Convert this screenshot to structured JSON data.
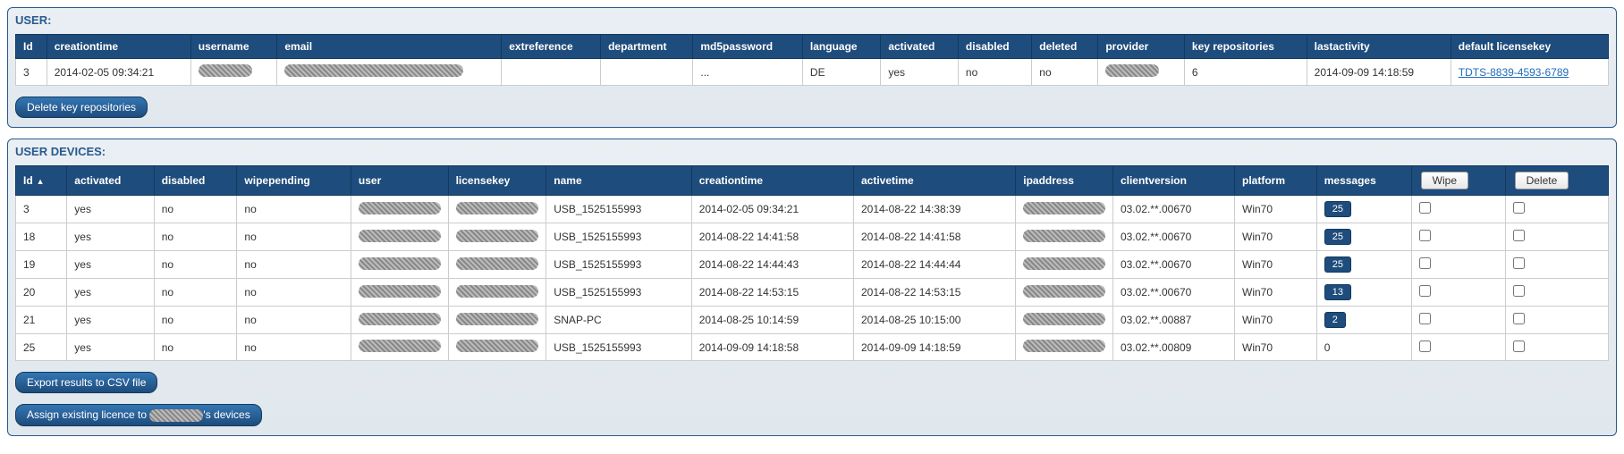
{
  "user_panel": {
    "title": "USER:",
    "headers": {
      "id": "Id",
      "creationtime": "creationtime",
      "username": "username",
      "email": "email",
      "extreference": "extreference",
      "department": "department",
      "md5password": "md5password",
      "language": "language",
      "activated": "activated",
      "disabled": "disabled",
      "deleted": "deleted",
      "provider": "provider",
      "keyrepos": "key repositories",
      "lastactivity": "lastactivity",
      "licensekey": "default licensekey"
    },
    "row": {
      "id": "3",
      "creationtime": "2014-02-05 09:34:21",
      "md5password": "...",
      "language": "DE",
      "activated": "yes",
      "disabled": "no",
      "deleted": "no",
      "keyrepos": "6",
      "lastactivity": "2014-09-09 14:18:59",
      "licensekey": "TDTS-8839-4593-6789"
    },
    "delete_button": "Delete key repositories"
  },
  "devices_panel": {
    "title": "USER DEVICES:",
    "headers": {
      "id": "Id",
      "activated": "activated",
      "disabled": "disabled",
      "wipepending": "wipepending",
      "user": "user",
      "licensekey": "licensekey",
      "name": "name",
      "creationtime": "creationtime",
      "activetime": "activetime",
      "ipaddress": "ipaddress",
      "clientversion": "clientversion",
      "platform": "platform",
      "messages": "messages",
      "wipe": "Wipe",
      "delete": "Delete"
    },
    "rows": [
      {
        "id": "3",
        "activated": "yes",
        "disabled": "no",
        "wipepending": "no",
        "name": "USB_1525155993",
        "creationtime": "2014-02-05 09:34:21",
        "activetime": "2014-08-22 14:38:39",
        "clientversion": "03.02.**.00670",
        "platform": "Win70",
        "messages": "25",
        "badge": true
      },
      {
        "id": "18",
        "activated": "yes",
        "disabled": "no",
        "wipepending": "no",
        "name": "USB_1525155993",
        "creationtime": "2014-08-22 14:41:58",
        "activetime": "2014-08-22 14:41:58",
        "clientversion": "03.02.**.00670",
        "platform": "Win70",
        "messages": "25",
        "badge": true
      },
      {
        "id": "19",
        "activated": "yes",
        "disabled": "no",
        "wipepending": "no",
        "name": "USB_1525155993",
        "creationtime": "2014-08-22 14:44:43",
        "activetime": "2014-08-22 14:44:44",
        "clientversion": "03.02.**.00670",
        "platform": "Win70",
        "messages": "25",
        "badge": true
      },
      {
        "id": "20",
        "activated": "yes",
        "disabled": "no",
        "wipepending": "no",
        "name": "USB_1525155993",
        "creationtime": "2014-08-22 14:53:15",
        "activetime": "2014-08-22 14:53:15",
        "clientversion": "03.02.**.00670",
        "platform": "Win70",
        "messages": "13",
        "badge": true
      },
      {
        "id": "21",
        "activated": "yes",
        "disabled": "no",
        "wipepending": "no",
        "name": "SNAP-PC",
        "creationtime": "2014-08-25 10:14:59",
        "activetime": "2014-08-25 10:15:00",
        "clientversion": "03.02.**.00887",
        "platform": "Win70",
        "messages": "2",
        "badge": true
      },
      {
        "id": "25",
        "activated": "yes",
        "disabled": "no",
        "wipepending": "no",
        "name": "USB_1525155993",
        "creationtime": "2014-09-09 14:18:58",
        "activetime": "2014-09-09 14:18:59",
        "clientversion": "03.02.**.00809",
        "platform": "Win70",
        "messages": "0",
        "badge": false
      }
    ],
    "export_button": "Export results to CSV file",
    "assign_button_prefix": "Assign existing licence to ",
    "assign_button_suffix": "'s devices"
  }
}
